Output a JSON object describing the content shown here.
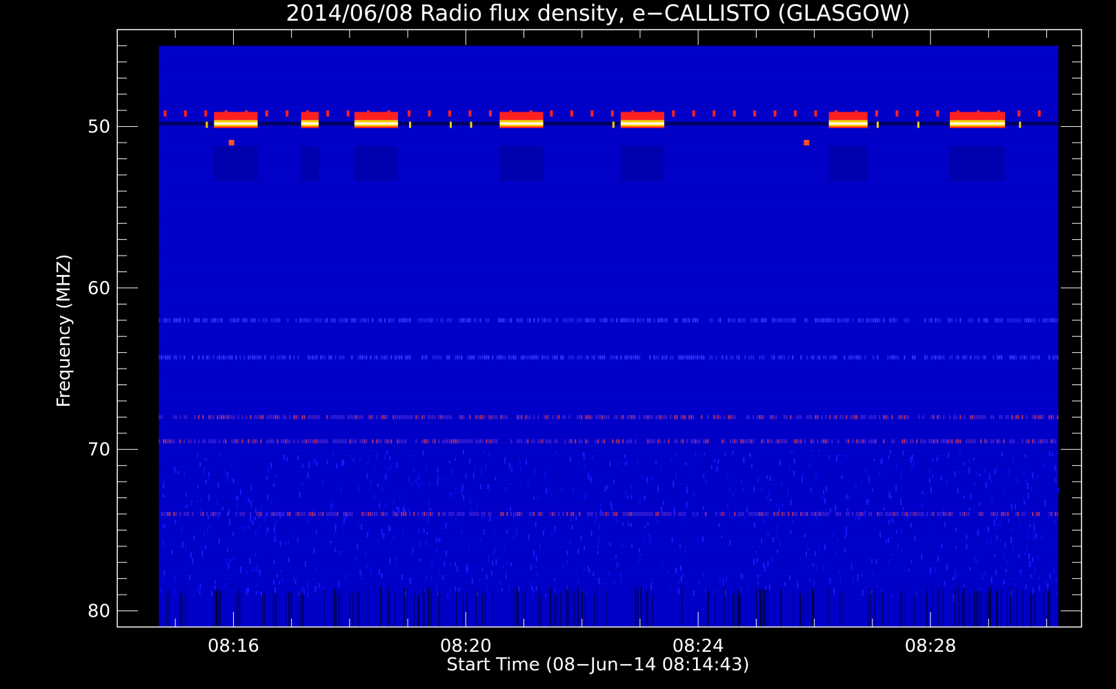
{
  "chart_data": {
    "type": "heatmap",
    "title": "2014/06/08  Radio flux density, e−CALLISTO (GLASGOW)",
    "xlabel": "Start Time (08−Jun−14 08:14:43)",
    "ylabel": "Frequency (MHZ)",
    "x_unit": "time (UT)",
    "y_unit": "MHz",
    "xlim": [
      "08:14:00",
      "08:30:36"
    ],
    "ylim": [
      81.0,
      44.0
    ],
    "y_axis_inverted": true,
    "data_extent": {
      "time": [
        "08:14:43",
        "08:30:12"
      ],
      "frequency": [
        45.0,
        81.0
      ]
    },
    "x_ticks": [
      "08:16",
      "08:20",
      "08:24",
      "08:28"
    ],
    "y_ticks": [
      50,
      60,
      70,
      80
    ],
    "colormap": "blue-red-yellow-white",
    "colors": {
      "background": "#0000c8",
      "low": "#000000",
      "mid": "#ff2020",
      "high": "#ffd000",
      "peak": "#ffffff"
    },
    "features": {
      "strong_band_50mhz_intervals": [
        [
          "08:15:40",
          "08:16:25"
        ],
        [
          "08:17:10",
          "08:17:28"
        ],
        [
          "08:18:05",
          "08:18:50"
        ],
        [
          "08:20:35",
          "08:21:20"
        ],
        [
          "08:22:40",
          "08:23:25"
        ],
        [
          "08:26:15",
          "08:26:55"
        ],
        [
          "08:28:20",
          "08:29:17"
        ]
      ],
      "point_sources": [
        {
          "time": "08:15:58",
          "frequency": 51.0
        },
        {
          "time": "08:25:52",
          "frequency": 51.0
        }
      ],
      "faint_bands_mhz": [
        62.0,
        64.3,
        68.0,
        69.5,
        74.0
      ],
      "dark_band_mhz": [
        78.5,
        81.0
      ]
    }
  }
}
